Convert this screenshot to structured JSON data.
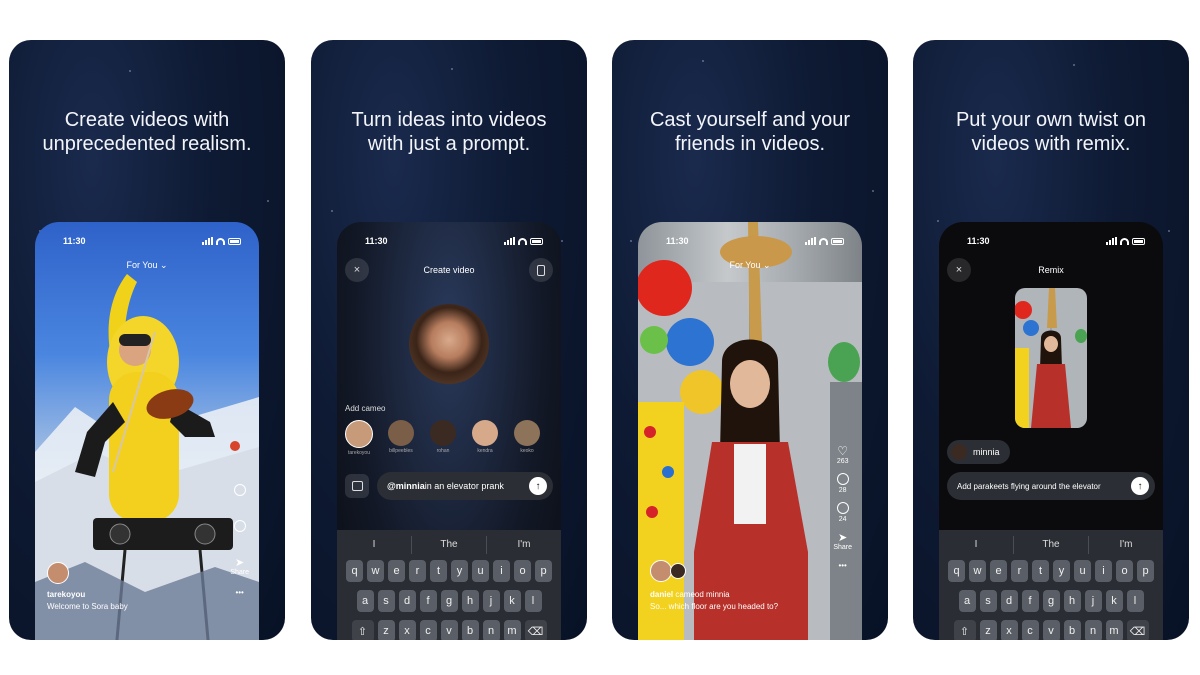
{
  "screens": [
    {
      "headline": [
        "Create videos with",
        "unprecedented realism."
      ],
      "time": "11:30",
      "feed_title": "For You",
      "username": "tarekoyou",
      "caption": "Welcome to Sora baby",
      "share_label": "Share",
      "page_dots": 5,
      "active_dot": 3
    },
    {
      "headline": [
        "Turn ideas into videos",
        "with just a prompt."
      ],
      "time": "11:30",
      "title": "Create video",
      "add_cameo_label": "Add cameo",
      "cameos": [
        "tarekoyou",
        "billpeebles",
        "rohan",
        "kendra",
        "keoko"
      ],
      "prompt_mention": "@minnia",
      "prompt_text": " in an elevator prank",
      "suggestions": [
        "I",
        "The",
        "I'm"
      ],
      "keys_row1": [
        "q",
        "w",
        "e",
        "r",
        "t",
        "y",
        "u",
        "i",
        "o",
        "p"
      ],
      "keys_row2": [
        "a",
        "s",
        "d",
        "f",
        "g",
        "h",
        "j",
        "k",
        "l"
      ],
      "keys_row3": [
        "z",
        "x",
        "c",
        "v",
        "b",
        "n",
        "m"
      ]
    },
    {
      "headline": [
        "Cast yourself and your",
        "friends in videos."
      ],
      "time": "11:30",
      "feed_title": "For You",
      "like_count": "263",
      "comment_count": "28",
      "remix_count": "24",
      "share_label": "Share",
      "caption_user": "daniel",
      "caption_action": " cameod minnia",
      "caption_text": "So... which floor are you headed to?",
      "page_dots": 5,
      "active_dot": 1
    },
    {
      "headline": [
        "Put your own twist on",
        "videos with remix."
      ],
      "time": "11:30",
      "title": "Remix",
      "cameo_tag": "minnia",
      "prompt_text": "Add parakeets flying around the elevator",
      "suggestions": [
        "I",
        "The",
        "I'm"
      ],
      "keys_row1": [
        "q",
        "w",
        "e",
        "r",
        "t",
        "y",
        "u",
        "i",
        "o",
        "p"
      ],
      "keys_row2": [
        "a",
        "s",
        "d",
        "f",
        "g",
        "h",
        "j",
        "k",
        "l"
      ],
      "keys_row3": [
        "z",
        "x",
        "c",
        "v",
        "b",
        "n",
        "m"
      ]
    }
  ],
  "icons": {
    "close": "×",
    "send": "↑",
    "shift": "⇧",
    "backspace": "⌫",
    "chevron": "⌄",
    "more": "•••"
  }
}
